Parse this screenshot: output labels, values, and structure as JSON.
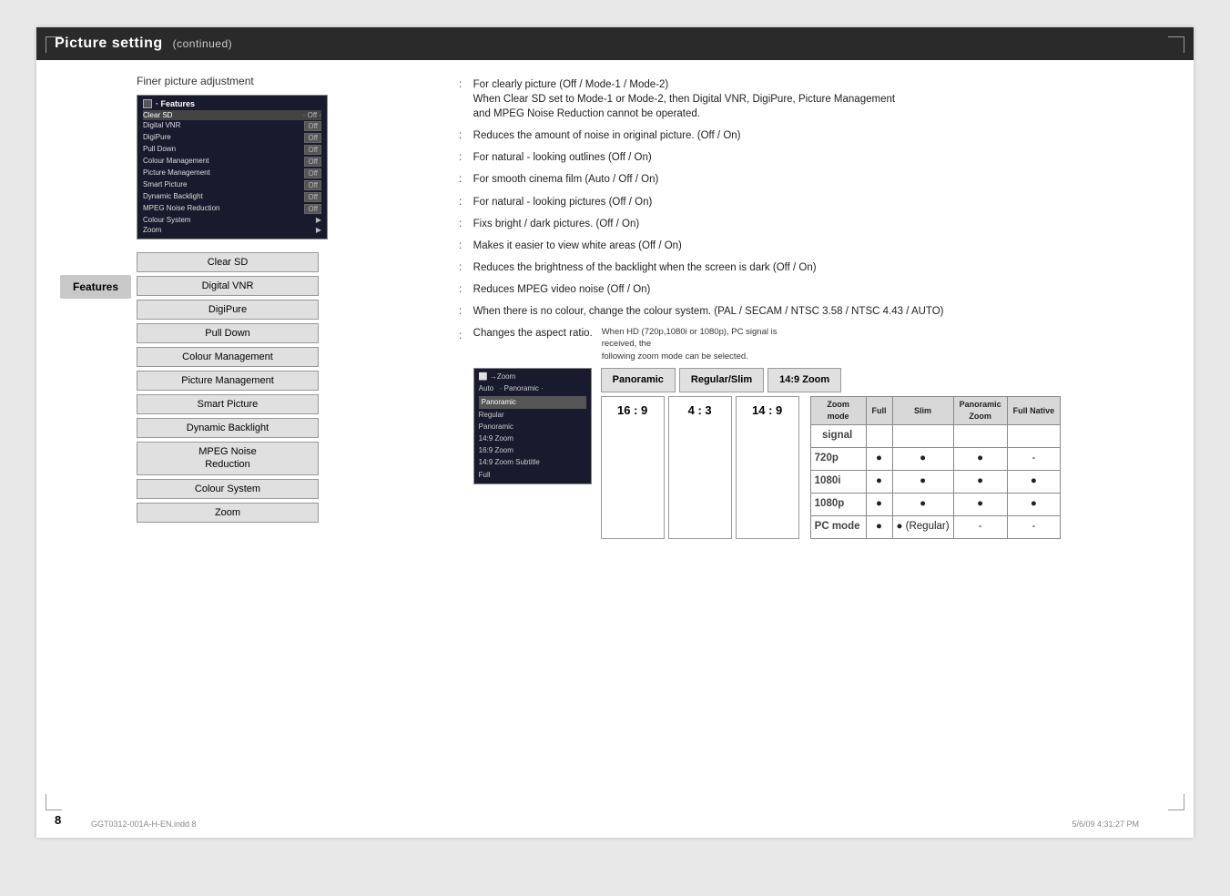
{
  "page": {
    "title": "Picture setting",
    "continued": "(continued)",
    "page_number": "8",
    "footer_file": "GGT0312-001A-H-EN.indd  8",
    "footer_date": "5/6/09  4:31:27 PM"
  },
  "finer_picture": {
    "title": "Finer picture adjustment"
  },
  "features_label": "Features",
  "menu": {
    "header": "Features",
    "items": [
      {
        "name": "Clear SD",
        "value": "Off",
        "highlighted": true
      },
      {
        "name": "Digital VNR",
        "value": "Off"
      },
      {
        "name": "DigiPure",
        "value": "Off"
      },
      {
        "name": "Pull Down",
        "value": "Off"
      },
      {
        "name": "Colour Management",
        "value": "Off"
      },
      {
        "name": "Picture Management",
        "value": "Off"
      },
      {
        "name": "Smart Picture",
        "value": "Off"
      },
      {
        "name": "Dynamic Backlight",
        "value": "Off"
      },
      {
        "name": "MPEG Noise Reduction",
        "value": "Off"
      },
      {
        "name": "Colour System",
        "value": ""
      },
      {
        "name": "Zoom",
        "value": ""
      }
    ]
  },
  "features": [
    {
      "id": "clear-sd",
      "label": "Clear SD"
    },
    {
      "id": "digital-vnr",
      "label": "Digital VNR"
    },
    {
      "id": "digipure",
      "label": "DigiPure"
    },
    {
      "id": "pull-down",
      "label": "Pull Down"
    },
    {
      "id": "colour-management",
      "label": "Colour Management"
    },
    {
      "id": "picture-management",
      "label": "Picture Management"
    },
    {
      "id": "smart-picture",
      "label": "Smart Picture"
    },
    {
      "id": "dynamic-backlight",
      "label": "Dynamic Backlight"
    },
    {
      "id": "mpeg-noise",
      "label": "MPEG Noise\nReduction",
      "double": true
    },
    {
      "id": "colour-system",
      "label": "Colour System"
    },
    {
      "id": "zoom",
      "label": "Zoom"
    }
  ],
  "descriptions": [
    {
      "id": "clear-sd",
      "colon": ":",
      "text": "For clearly picture (Off / Mode-1 / Mode-2)\nWhen Clear SD set to Mode-1 or Mode-2, then Digital VNR, DigiPure, Picture Management\nand MPEG Noise Reduction cannot be operated."
    },
    {
      "id": "digital-vnr",
      "colon": ":",
      "text": "Reduces the amount of noise in original picture. (Off / On)"
    },
    {
      "id": "digipure",
      "colon": ":",
      "text": "For natural - looking outlines (Off / On)"
    },
    {
      "id": "pull-down",
      "colon": ":",
      "text": "For smooth cinema film (Auto / Off / On)"
    },
    {
      "id": "colour-management",
      "colon": ":",
      "text": "For natural - looking pictures (Off / On)"
    },
    {
      "id": "picture-management",
      "colon": ":",
      "text": "Fixs bright / dark pictures. (Off / On)"
    },
    {
      "id": "smart-picture",
      "colon": ":",
      "text": "Makes it easier to view white areas (Off / On)"
    },
    {
      "id": "dynamic-backlight",
      "colon": ":",
      "text": "Reduces the brightness of the backlight when the screen is dark (Off / On)"
    },
    {
      "id": "mpeg-noise",
      "colon": ":",
      "text": "Reduces MPEG video noise (Off / On)"
    },
    {
      "id": "colour-system",
      "colon": ":",
      "text": "When there is no colour, change the colour system. (PAL / SECAM / NTSC 3.58 / NTSC 4.43 / AUTO)"
    }
  ],
  "zoom_section": {
    "menu": {
      "header": "→Zoom",
      "sub": "Auto",
      "items": [
        {
          "name": "Panoramic",
          "selected": true
        },
        {
          "name": "Regular"
        },
        {
          "name": "Panoramic"
        },
        {
          "name": "14:9 Zoom"
        },
        {
          "name": "16:9 Zoom"
        },
        {
          "name": "14:9 Zoom Subtitle"
        },
        {
          "name": "Full"
        }
      ]
    },
    "buttons": [
      "Panoramic",
      "Regular/Slim",
      "14:9 Zoom"
    ],
    "ratios": [
      "16 : 9",
      "4 : 3",
      "14 : 9"
    ],
    "desc_colon": ":",
    "desc": "Changes the aspect ratio.",
    "hd_desc": "When HD (720p,1080i or 1080p), PC signal is received, the\nfollowing zoom mode can be selected.",
    "hd_table": {
      "headers": [
        "Zoom\nmode",
        "Full",
        "Slim",
        "Panoramic\nZoom",
        "Full Native"
      ],
      "rows": [
        {
          "signal": "720p",
          "full": "●",
          "slim": "●",
          "pano": "●",
          "fn": "-"
        },
        {
          "signal": "1080i",
          "full": "●",
          "slim": "●",
          "pano": "●",
          "fn": "●"
        },
        {
          "signal": "1080p",
          "full": "●",
          "slim": "●",
          "pano": "●",
          "fn": "●"
        },
        {
          "signal": "PC mode",
          "full": "●",
          "slim": "● (Regular)",
          "pano": "-",
          "fn": "-"
        }
      ]
    }
  }
}
